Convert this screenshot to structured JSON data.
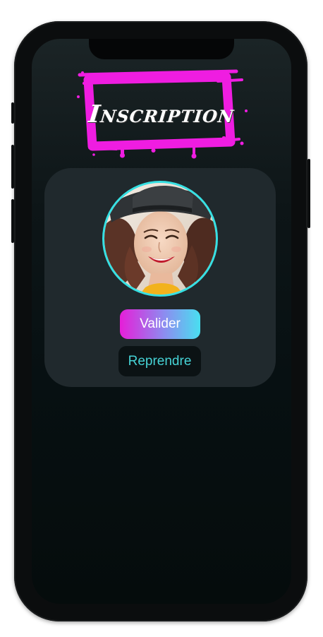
{
  "header": {
    "title": "Inscription"
  },
  "profile": {
    "avatar_icon": "portrait-photo"
  },
  "actions": {
    "validate_label": "Valider",
    "retake_label": "Reprendre"
  },
  "colors": {
    "accent_magenta": "#e61ed8",
    "accent_cyan": "#36e0e3",
    "card_bg": "#20292d",
    "screen_bg": "#071012"
  }
}
